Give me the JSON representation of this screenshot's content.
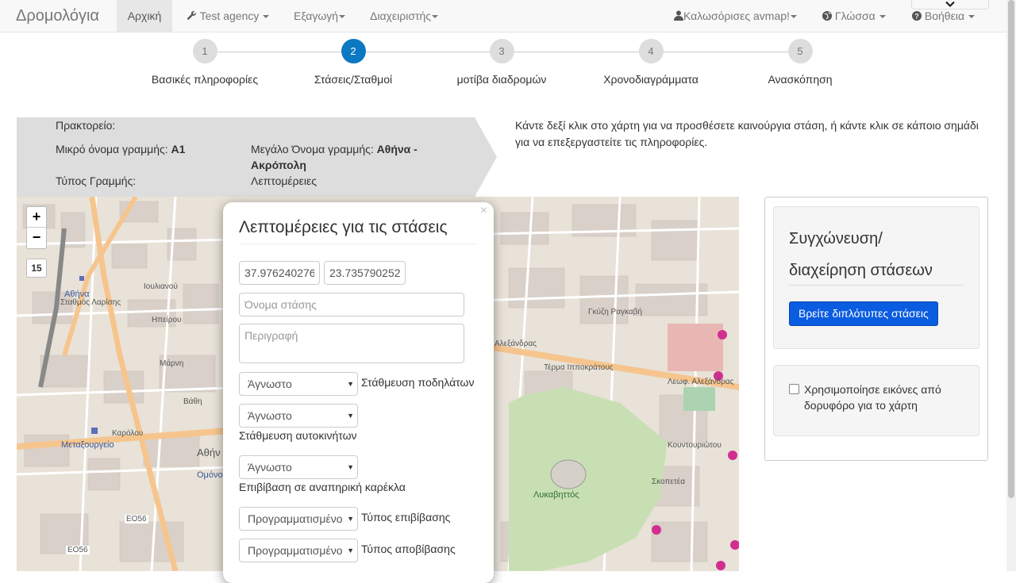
{
  "navbar": {
    "brand": "Δρομολόγια",
    "home": "Αρχική",
    "agency": "Test agency",
    "export": "Εξαγωγή",
    "admin": "Διαχειριστής",
    "user": "Καλωσόρισες avmap!",
    "language": "Γλώσσα",
    "help": "Βοήθεια"
  },
  "wizard": {
    "steps": [
      {
        "num": "1",
        "label": "Βασικές πληροφορίες"
      },
      {
        "num": "2",
        "label": "Στάσεις/Σταθμοί"
      },
      {
        "num": "3",
        "label": "μοτίβα διαδρομών"
      },
      {
        "num": "4",
        "label": "Χρονοδιαγράμματα"
      },
      {
        "num": "5",
        "label": "Ανασκόπηση"
      }
    ],
    "active_step": 2
  },
  "route_info": {
    "agency_label": "Πρακτορείο:",
    "short_name_label": "Μικρό όνομα γραμμής:",
    "short_name": "A1",
    "long_name_label": "Μεγάλο Όνομα γραμμής:",
    "long_name_line1": "Αθήνα -",
    "long_name_line2": "Ακρόπολη",
    "type_label": "Τύπος Γραμμής:",
    "details_link": "Λεπτομέρειες"
  },
  "hint": "Κάντε δεξί κλικ στο χάρτη για να προσθέσετε καινούργια στάση, ή κάντε κλικ σε κάποιο σημάδι για να επεξεργαστείτε τις πληροφορίες.",
  "map": {
    "zoom_in": "+",
    "zoom_out": "−",
    "zoom_level": "15",
    "labels": {
      "athens": "Αθήνα",
      "larisa": "Σταθμός Λαρίσης",
      "metaxourgeio": "Μεταξουργείο",
      "lykavittos": "Λυκαβηττός",
      "alexandras": "Αλεξάνδρας",
      "alexandras2": "Λεωφ. Αλεξάνδρας",
      "ioulianou": "Ιουλιανού",
      "epirou": "Ηπείρου",
      "karolou": "Καρόλου",
      "eo56": "ΕΟ56",
      "eo56b": "ΕΟ56",
      "omonoia": "Ομόνοια",
      "athin": "Αθήν",
      "termaippokratous": "Τέρμα Ιπποκράτους",
      "kountouriotou": "Κουντουριώτου",
      "skopetea": "Σκοπετέα",
      "gkyzi": "Γκύζη Ραγκαβή",
      "marni": "Μάρνη",
      "vathi": "Βάθη"
    }
  },
  "stop_popup": {
    "title": "Λεπτομέρειες για τις στάσεις",
    "close": "×",
    "lat": "37.976240276",
    "lon": "23.735790252",
    "name_placeholder": "Όνομα στάσης",
    "desc_placeholder": "Περιγραφή",
    "bike_parking": {
      "value": "Άγνωστο",
      "label": "Στάθμευση ποδηλάτων"
    },
    "car_parking": {
      "value": "Άγνωστο",
      "label": "Στάθμευση αυτοκινήτων"
    },
    "wheelchair": {
      "value": "Άγνωστο",
      "label": "Επιβίβαση σε αναπηρική καρέκλα"
    },
    "pickup_type": {
      "value": "Προγραμματισμένο",
      "label": "Τύπος επιβίβασης"
    },
    "dropoff_type": {
      "value": "Προγραμματισμένο",
      "label": "Τύπος αποβίβασης"
    }
  },
  "side_panel": {
    "title": "Συγχώνευση/ διαχείρηση στάσεων",
    "find_duplicates": "Βρείτε διπλότυπες στάσεις",
    "satellite_label": "Χρησιμοποίησε εικόνες από δορυφόρο για το χάρτη"
  }
}
